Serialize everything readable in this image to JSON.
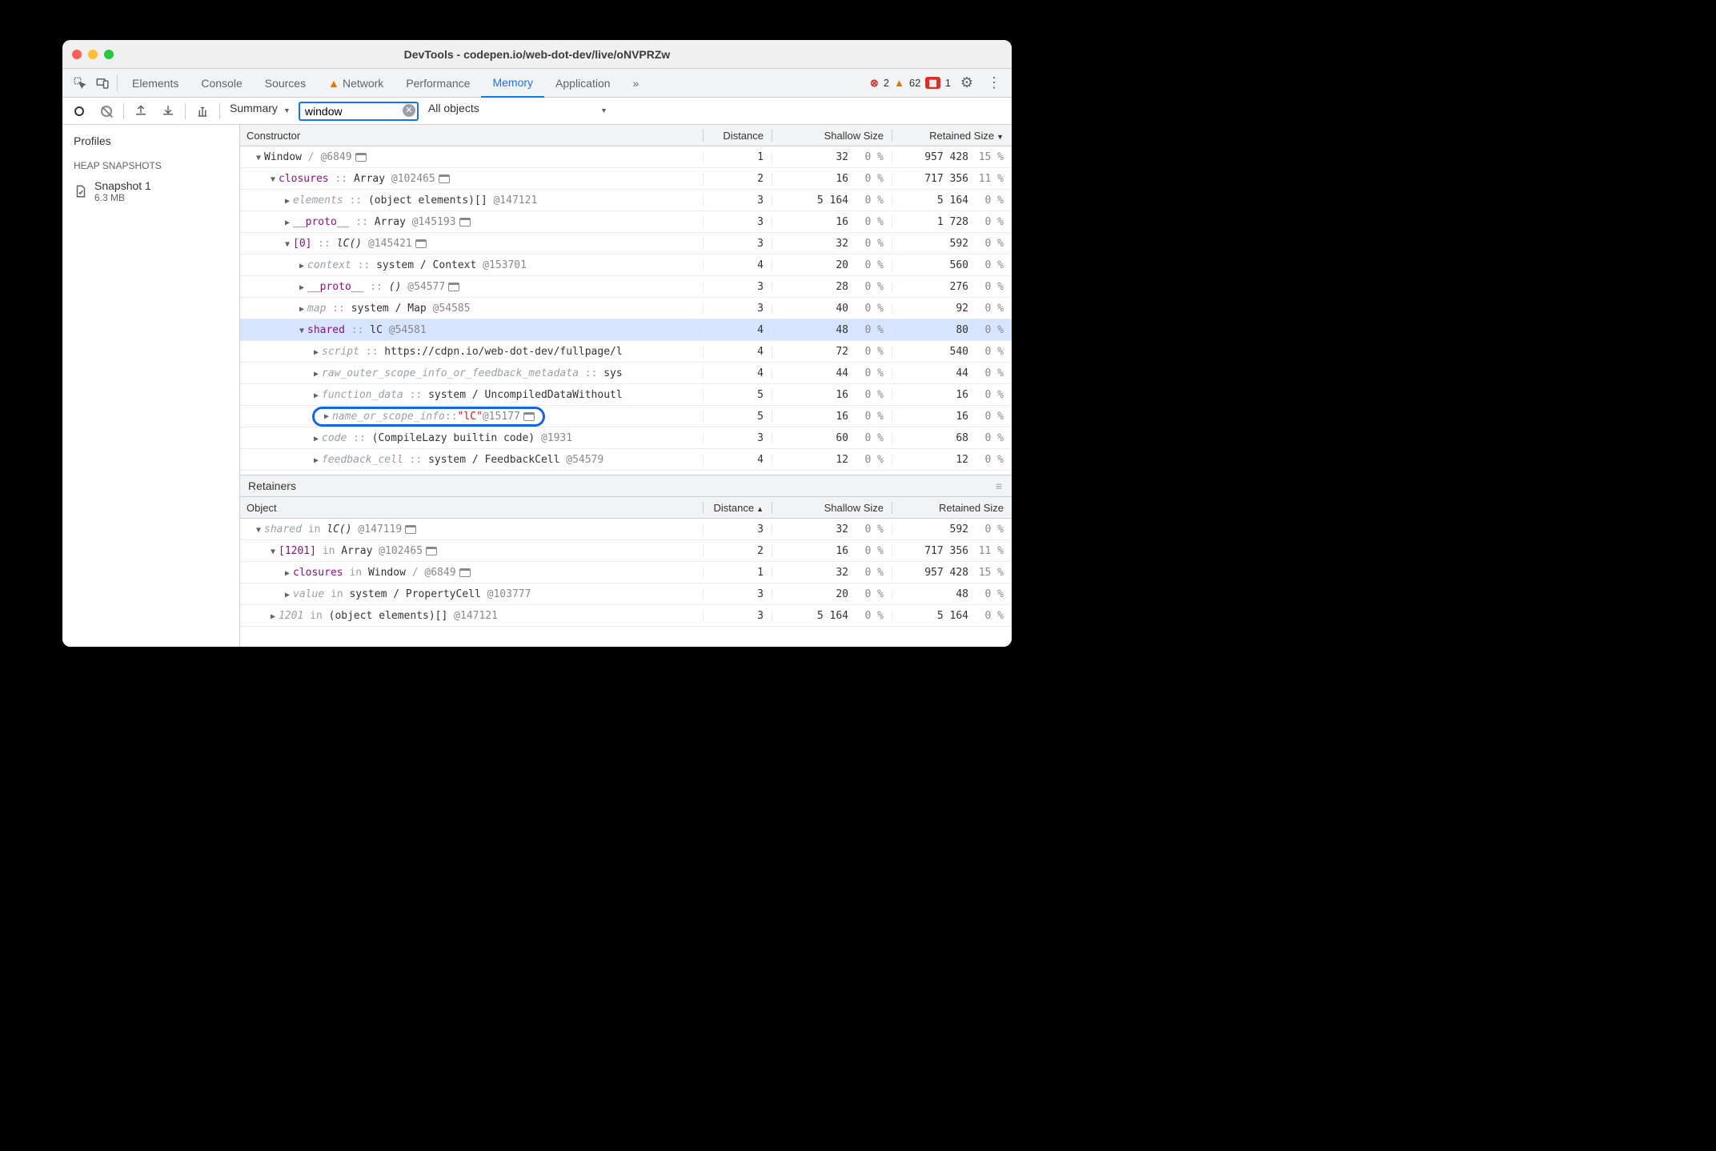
{
  "window": {
    "title": "DevTools - codepen.io/web-dot-dev/live/oNVPRZw"
  },
  "tabs": {
    "elements": "Elements",
    "console": "Console",
    "sources": "Sources",
    "network": "Network",
    "performance": "Performance",
    "memory": "Memory",
    "application": "Application",
    "overflow": "»"
  },
  "counts": {
    "errors": "2",
    "warnings": "62",
    "issues": "1"
  },
  "toolbar": {
    "summary": "Summary",
    "filter_value": "window",
    "all_objects": "All objects"
  },
  "sidebar": {
    "profiles": "Profiles",
    "heap_label": "HEAP SNAPSHOTS",
    "snapshot": {
      "name": "Snapshot 1",
      "size": "6.3 MB"
    }
  },
  "headers": {
    "constructor": "Constructor",
    "distance": "Distance",
    "shallow": "Shallow Size",
    "retained": "Retained Size",
    "object": "Object"
  },
  "rows": [
    {
      "indent": 0,
      "exp": "down",
      "parts": [
        [
          "txt",
          "Window "
        ],
        [
          "dim",
          "/"
        ],
        [
          "id",
          "   @6849"
        ],
        [
          "win",
          ""
        ]
      ],
      "d": "1",
      "s": "32",
      "sp": "0 %",
      "r": "957 428",
      "rp": "15 %"
    },
    {
      "indent": 1,
      "exp": "down",
      "parts": [
        [
          "prop",
          "closures"
        ],
        [
          "dim",
          " :: "
        ],
        [
          "txt",
          "Array "
        ],
        [
          "id",
          "@102465"
        ],
        [
          "win",
          ""
        ]
      ],
      "d": "2",
      "s": "16",
      "sp": "0 %",
      "r": "717 356",
      "rp": "11 %"
    },
    {
      "indent": 2,
      "exp": "right",
      "parts": [
        [
          "dim-i",
          "elements"
        ],
        [
          "dim",
          " :: "
        ],
        [
          "txt",
          "(object elements)[] "
        ],
        [
          "id",
          "@147121"
        ]
      ],
      "d": "3",
      "s": "5 164",
      "sp": "0 %",
      "r": "5 164",
      "rp": "0 %"
    },
    {
      "indent": 2,
      "exp": "right",
      "parts": [
        [
          "prop",
          "__proto__"
        ],
        [
          "dim",
          " :: "
        ],
        [
          "txt",
          "Array "
        ],
        [
          "id",
          "@145193"
        ],
        [
          "win",
          ""
        ]
      ],
      "d": "3",
      "s": "16",
      "sp": "0 %",
      "r": "1 728",
      "rp": "0 %"
    },
    {
      "indent": 2,
      "exp": "down",
      "parts": [
        [
          "prop",
          "[0]"
        ],
        [
          "dim",
          " :: "
        ],
        [
          "i",
          "lC() "
        ],
        [
          "id",
          "@145421"
        ],
        [
          "win",
          ""
        ]
      ],
      "d": "3",
      "s": "32",
      "sp": "0 %",
      "r": "592",
      "rp": "0 %"
    },
    {
      "indent": 3,
      "exp": "right",
      "parts": [
        [
          "dim-i",
          "context"
        ],
        [
          "dim",
          " :: "
        ],
        [
          "txt",
          "system / Context "
        ],
        [
          "id",
          "@153701"
        ]
      ],
      "d": "4",
      "s": "20",
      "sp": "0 %",
      "r": "560",
      "rp": "0 %"
    },
    {
      "indent": 3,
      "exp": "right",
      "parts": [
        [
          "prop",
          "__proto__"
        ],
        [
          "dim",
          " :: "
        ],
        [
          "i",
          "() "
        ],
        [
          "id",
          "@54577"
        ],
        [
          "win",
          ""
        ]
      ],
      "d": "3",
      "s": "28",
      "sp": "0 %",
      "r": "276",
      "rp": "0 %"
    },
    {
      "indent": 3,
      "exp": "right",
      "parts": [
        [
          "dim-i",
          "map"
        ],
        [
          "dim",
          " :: "
        ],
        [
          "txt",
          "system / Map "
        ],
        [
          "id",
          "@54585"
        ]
      ],
      "d": "3",
      "s": "40",
      "sp": "0 %",
      "r": "92",
      "rp": "0 %"
    },
    {
      "indent": 3,
      "exp": "down",
      "sel": true,
      "parts": [
        [
          "prop",
          "shared"
        ],
        [
          "dim",
          " :: "
        ],
        [
          "txt",
          "lC "
        ],
        [
          "id",
          "@54581"
        ]
      ],
      "d": "4",
      "s": "48",
      "sp": "0 %",
      "r": "80",
      "rp": "0 %"
    },
    {
      "indent": 4,
      "exp": "right",
      "parts": [
        [
          "dim-i",
          "script"
        ],
        [
          "dim",
          " :: "
        ],
        [
          "txt",
          "https://cdpn.io/web-dot-dev/fullpage/l"
        ]
      ],
      "d": "4",
      "s": "72",
      "sp": "0 %",
      "r": "540",
      "rp": "0 %"
    },
    {
      "indent": 4,
      "exp": "right",
      "parts": [
        [
          "dim-i",
          "raw_outer_scope_info_or_feedback_metadata"
        ],
        [
          "dim",
          " :: "
        ],
        [
          "txt",
          "sys"
        ]
      ],
      "d": "4",
      "s": "44",
      "sp": "0 %",
      "r": "44",
      "rp": "0 %"
    },
    {
      "indent": 4,
      "exp": "right",
      "parts": [
        [
          "dim-i",
          "function_data"
        ],
        [
          "dim",
          " :: "
        ],
        [
          "txt",
          "system / UncompiledDataWithoutl"
        ]
      ],
      "d": "5",
      "s": "16",
      "sp": "0 %",
      "r": "16",
      "rp": "0 %"
    },
    {
      "indent": 4,
      "exp": "right",
      "hl": true,
      "parts": [
        [
          "dim-i",
          "name_or_scope_info"
        ],
        [
          "dim",
          " :: "
        ],
        [
          "str",
          "\"lC\""
        ],
        [
          "id",
          " @15177"
        ],
        [
          "win",
          ""
        ]
      ],
      "d": "5",
      "s": "16",
      "sp": "0 %",
      "r": "16",
      "rp": "0 %"
    },
    {
      "indent": 4,
      "exp": "right",
      "parts": [
        [
          "dim-i",
          "code"
        ],
        [
          "dim",
          " :: "
        ],
        [
          "txt",
          "(CompileLazy builtin code) "
        ],
        [
          "id",
          "@1931"
        ]
      ],
      "d": "3",
      "s": "60",
      "sp": "0 %",
      "r": "68",
      "rp": "0 %"
    },
    {
      "indent": 4,
      "exp": "right",
      "parts": [
        [
          "dim-i",
          "feedback_cell"
        ],
        [
          "dim",
          " :: "
        ],
        [
          "txt",
          "system / FeedbackCell "
        ],
        [
          "id",
          "@54579"
        ]
      ],
      "d": "4",
      "s": "12",
      "sp": "0 %",
      "r": "12",
      "rp": "0 %"
    }
  ],
  "retainers_label": "Retainers",
  "ret_rows": [
    {
      "indent": 0,
      "exp": "down",
      "parts": [
        [
          "dim-i",
          "shared"
        ],
        [
          "dim",
          " in "
        ],
        [
          "i",
          "lC() "
        ],
        [
          "id",
          "@147119"
        ],
        [
          "win",
          ""
        ]
      ],
      "d": "3",
      "s": "32",
      "sp": "0 %",
      "r": "592",
      "rp": "0 %"
    },
    {
      "indent": 1,
      "exp": "down",
      "parts": [
        [
          "prop",
          "[1201]"
        ],
        [
          "dim",
          " in "
        ],
        [
          "txt",
          "Array "
        ],
        [
          "id",
          "@102465"
        ],
        [
          "win",
          ""
        ]
      ],
      "d": "2",
      "s": "16",
      "sp": "0 %",
      "r": "717 356",
      "rp": "11 %"
    },
    {
      "indent": 2,
      "exp": "right",
      "parts": [
        [
          "prop",
          "closures"
        ],
        [
          "dim",
          " in "
        ],
        [
          "txt",
          "Window "
        ],
        [
          "dim",
          "/   "
        ],
        [
          "id",
          "@6849"
        ],
        [
          "win",
          ""
        ]
      ],
      "d": "1",
      "s": "32",
      "sp": "0 %",
      "r": "957 428",
      "rp": "15 %"
    },
    {
      "indent": 2,
      "exp": "right",
      "parts": [
        [
          "dim-i",
          "value"
        ],
        [
          "dim",
          " in "
        ],
        [
          "txt",
          "system / PropertyCell "
        ],
        [
          "id",
          "@103777"
        ]
      ],
      "d": "3",
      "s": "20",
      "sp": "0 %",
      "r": "48",
      "rp": "0 %"
    },
    {
      "indent": 1,
      "exp": "right",
      "parts": [
        [
          "dim-i",
          "1201"
        ],
        [
          "dim",
          " in "
        ],
        [
          "txt",
          "(object elements)[] "
        ],
        [
          "id",
          "@147121"
        ]
      ],
      "d": "3",
      "s": "5 164",
      "sp": "0 %",
      "r": "5 164",
      "rp": "0 %"
    }
  ]
}
